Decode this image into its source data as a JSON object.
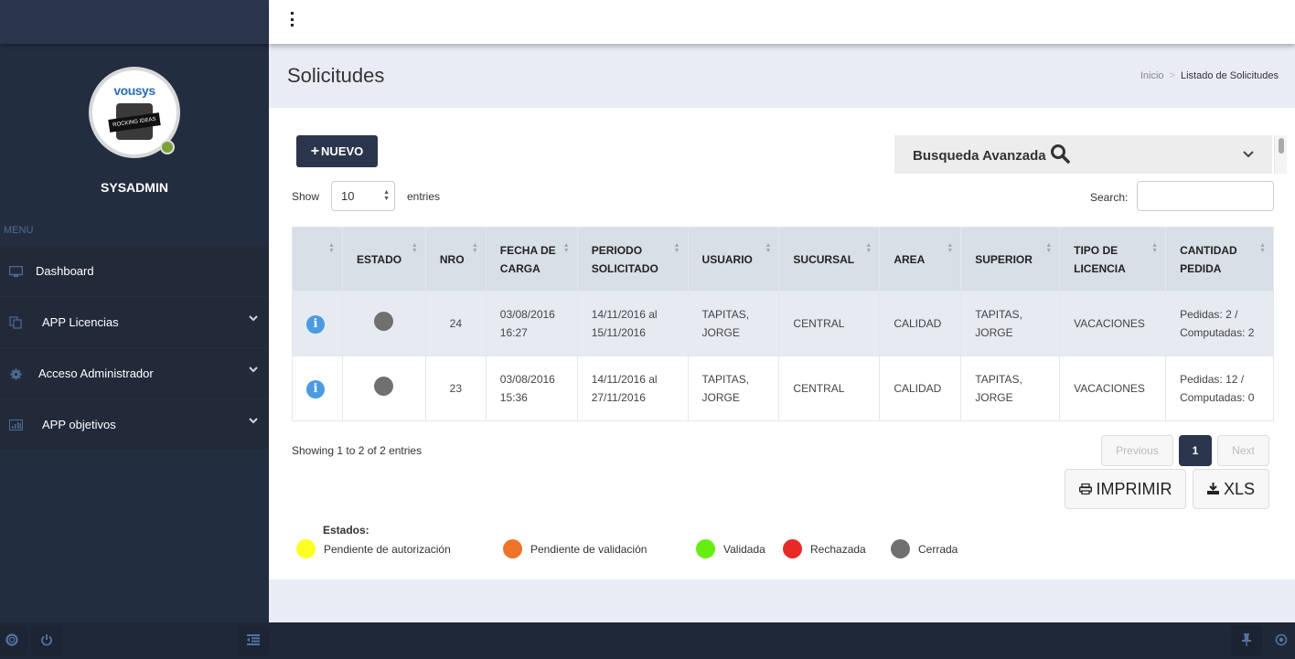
{
  "sidebar": {
    "username": "SYSADMIN",
    "avatar_logo_text": "vousys",
    "avatar_label": "ROCKING IDEAS",
    "online_status_color": "#7ba23a",
    "menu_label": "MENU",
    "items": [
      {
        "label": "Dashboard",
        "icon": "monitor-icon",
        "has_submenu": false
      },
      {
        "label": "APP Licencias",
        "icon": "copy-icon",
        "has_submenu": true
      },
      {
        "label": "Acceso Administrador",
        "icon": "gear-icon",
        "has_submenu": true
      },
      {
        "label": "APP objetivos",
        "icon": "bar-chart-icon",
        "has_submenu": true
      }
    ],
    "footer_icons": [
      "lifebuoy-icon",
      "power-icon",
      "collapse-menu-icon"
    ]
  },
  "topbar": {
    "menu_icon": "kebab-menu-icon",
    "right_icons": [
      "pin-icon",
      "target-icon"
    ]
  },
  "header": {
    "title": "Solicitudes",
    "breadcrumb": {
      "home": "Inicio",
      "separator": ">",
      "current": "Listado de Solicitudes"
    }
  },
  "toolbar": {
    "new_button": "NUEVO",
    "advanced_search": "Busqueda Avanzada",
    "show_label": "Show",
    "entries_value": "10",
    "entries_label": "entries",
    "search_label": "Search:",
    "search_value": ""
  },
  "table": {
    "columns": [
      "",
      "ESTADO",
      "NRO",
      "FECHA DE CARGA",
      "PERIODO SOLICITADO",
      "USUARIO",
      "SUCURSAL",
      "AREA",
      "SUPERIOR",
      "TIPO DE LICENCIA",
      "CANTIDAD PEDIDA"
    ],
    "columns_line1": [
      "",
      "ESTADO",
      "NRO",
      "FECHA DE",
      "PERIODO",
      "USUARIO",
      "SUCURSAL",
      "AREA",
      "SUPERIOR",
      "TIPO DE",
      "CANTIDAD"
    ],
    "columns_line2": [
      "",
      "",
      "",
      "CARGA",
      "SOLICITADO",
      "",
      "",
      "",
      "",
      "LICENCIA",
      "PEDIDA"
    ],
    "rows": [
      {
        "estado": "Cerrada",
        "estado_color": "#707070",
        "nro": "24",
        "fecha_1": "03/08/2016",
        "fecha_2": "16:27",
        "periodo_1": "14/11/2016 al",
        "periodo_2": "15/11/2016",
        "usuario_1": "TAPITAS,",
        "usuario_2": "JORGE",
        "sucursal": "CENTRAL",
        "area": "CALIDAD",
        "superior_1": "TAPITAS,",
        "superior_2": "JORGE",
        "tipo": "VACACIONES",
        "cantidad_1": "Pedidas: 2 /",
        "cantidad_2": "Computadas: 2"
      },
      {
        "estado": "Cerrada",
        "estado_color": "#707070",
        "nro": "23",
        "fecha_1": "03/08/2016",
        "fecha_2": "15:36",
        "periodo_1": "14/11/2016 al",
        "periodo_2": "27/11/2016",
        "usuario_1": "TAPITAS,",
        "usuario_2": "JORGE",
        "sucursal": "CENTRAL",
        "area": "CALIDAD",
        "superior_1": "TAPITAS,",
        "superior_2": "JORGE",
        "tipo": "VACACIONES",
        "cantidad_1": "Pedidas: 12 /",
        "cantidad_2": "Computadas: 0"
      }
    ]
  },
  "pagination": {
    "info": "Showing 1 to 2 of 2 entries",
    "previous": "Previous",
    "current_page": "1",
    "next": "Next"
  },
  "export": {
    "print": "IMPRIMIR",
    "xls": "XLS"
  },
  "legend": {
    "title": "Estados:",
    "items": [
      {
        "label": "Pendiente de autorización",
        "color": "#ffff22"
      },
      {
        "label": "Pendiente de validación",
        "color": "#ee7428"
      },
      {
        "label": "Validada",
        "color": "#66ee11"
      },
      {
        "label": "Rechazada",
        "color": "#e82a26"
      },
      {
        "label": "Cerrada",
        "color": "#707070"
      }
    ]
  },
  "colors": {
    "sidebar_bg": "#232d40",
    "accent": "#2b364d",
    "info_icon": "#4a9be0"
  }
}
